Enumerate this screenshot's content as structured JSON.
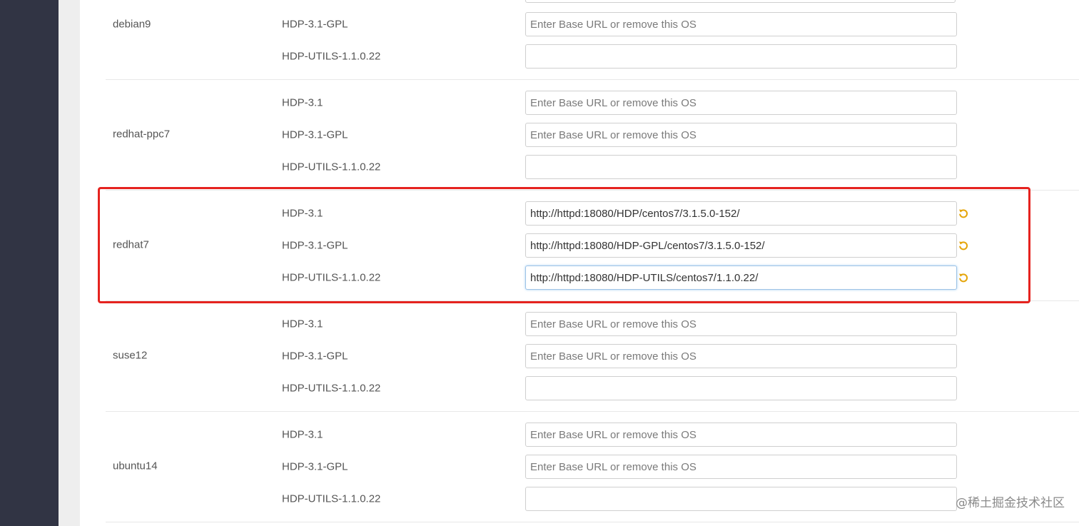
{
  "placeholder": "Enter Base URL or remove this OS",
  "accent_color": "#e5a50a",
  "highlight_color": "#e5231f",
  "os_groups": [
    {
      "name": "debian9",
      "repos": [
        {
          "name": "HDP-3.1-GPL",
          "value": ""
        },
        {
          "name": "HDP-UTILS-1.1.0.22",
          "value": ""
        }
      ]
    },
    {
      "name": "redhat-ppc7",
      "repos": [
        {
          "name": "HDP-3.1",
          "value": ""
        },
        {
          "name": "HDP-3.1-GPL",
          "value": ""
        },
        {
          "name": "HDP-UTILS-1.1.0.22",
          "value": ""
        }
      ]
    },
    {
      "name": "redhat7",
      "repos": [
        {
          "name": "HDP-3.1",
          "value": "http://httpd:18080/HDP/centos7/3.1.5.0-152/",
          "undo_icon": "undo-icon"
        },
        {
          "name": "HDP-3.1-GPL",
          "value": "http://httpd:18080/HDP-GPL/centos7/3.1.5.0-152/",
          "undo_icon": "undo-icon"
        },
        {
          "name": "HDP-UTILS-1.1.0.22",
          "value": "http://httpd:18080/HDP-UTILS/centos7/1.1.0.22/",
          "undo_icon": "undo-icon"
        }
      ]
    },
    {
      "name": "suse12",
      "repos": [
        {
          "name": "HDP-3.1",
          "value": ""
        },
        {
          "name": "HDP-3.1-GPL",
          "value": ""
        },
        {
          "name": "HDP-UTILS-1.1.0.22",
          "value": ""
        }
      ]
    },
    {
      "name": "ubuntu14",
      "repos": [
        {
          "name": "HDP-3.1",
          "value": ""
        },
        {
          "name": "HDP-3.1-GPL",
          "value": ""
        },
        {
          "name": "HDP-UTILS-1.1.0.22",
          "value": ""
        }
      ]
    }
  ],
  "watermark": "@稀土掘金技术社区"
}
